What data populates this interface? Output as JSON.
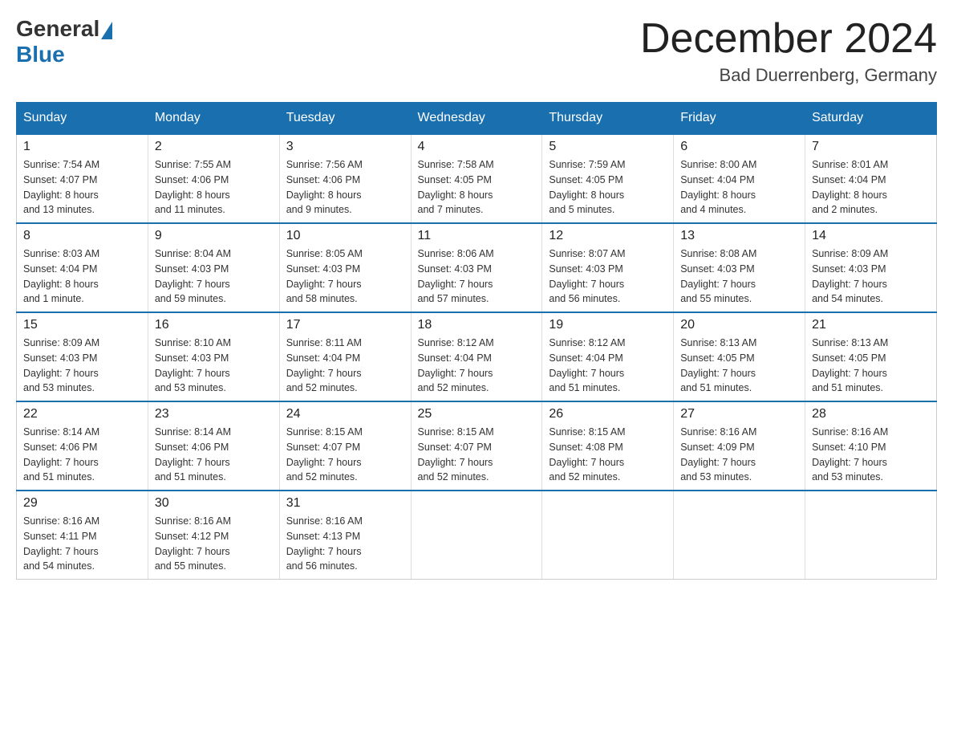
{
  "logo": {
    "general": "General",
    "blue": "Blue"
  },
  "title": {
    "month_year": "December 2024",
    "location": "Bad Duerrenberg, Germany"
  },
  "headers": [
    "Sunday",
    "Monday",
    "Tuesday",
    "Wednesday",
    "Thursday",
    "Friday",
    "Saturday"
  ],
  "weeks": [
    [
      {
        "day": "1",
        "info": "Sunrise: 7:54 AM\nSunset: 4:07 PM\nDaylight: 8 hours\nand 13 minutes."
      },
      {
        "day": "2",
        "info": "Sunrise: 7:55 AM\nSunset: 4:06 PM\nDaylight: 8 hours\nand 11 minutes."
      },
      {
        "day": "3",
        "info": "Sunrise: 7:56 AM\nSunset: 4:06 PM\nDaylight: 8 hours\nand 9 minutes."
      },
      {
        "day": "4",
        "info": "Sunrise: 7:58 AM\nSunset: 4:05 PM\nDaylight: 8 hours\nand 7 minutes."
      },
      {
        "day": "5",
        "info": "Sunrise: 7:59 AM\nSunset: 4:05 PM\nDaylight: 8 hours\nand 5 minutes."
      },
      {
        "day": "6",
        "info": "Sunrise: 8:00 AM\nSunset: 4:04 PM\nDaylight: 8 hours\nand 4 minutes."
      },
      {
        "day": "7",
        "info": "Sunrise: 8:01 AM\nSunset: 4:04 PM\nDaylight: 8 hours\nand 2 minutes."
      }
    ],
    [
      {
        "day": "8",
        "info": "Sunrise: 8:03 AM\nSunset: 4:04 PM\nDaylight: 8 hours\nand 1 minute."
      },
      {
        "day": "9",
        "info": "Sunrise: 8:04 AM\nSunset: 4:03 PM\nDaylight: 7 hours\nand 59 minutes."
      },
      {
        "day": "10",
        "info": "Sunrise: 8:05 AM\nSunset: 4:03 PM\nDaylight: 7 hours\nand 58 minutes."
      },
      {
        "day": "11",
        "info": "Sunrise: 8:06 AM\nSunset: 4:03 PM\nDaylight: 7 hours\nand 57 minutes."
      },
      {
        "day": "12",
        "info": "Sunrise: 8:07 AM\nSunset: 4:03 PM\nDaylight: 7 hours\nand 56 minutes."
      },
      {
        "day": "13",
        "info": "Sunrise: 8:08 AM\nSunset: 4:03 PM\nDaylight: 7 hours\nand 55 minutes."
      },
      {
        "day": "14",
        "info": "Sunrise: 8:09 AM\nSunset: 4:03 PM\nDaylight: 7 hours\nand 54 minutes."
      }
    ],
    [
      {
        "day": "15",
        "info": "Sunrise: 8:09 AM\nSunset: 4:03 PM\nDaylight: 7 hours\nand 53 minutes."
      },
      {
        "day": "16",
        "info": "Sunrise: 8:10 AM\nSunset: 4:03 PM\nDaylight: 7 hours\nand 53 minutes."
      },
      {
        "day": "17",
        "info": "Sunrise: 8:11 AM\nSunset: 4:04 PM\nDaylight: 7 hours\nand 52 minutes."
      },
      {
        "day": "18",
        "info": "Sunrise: 8:12 AM\nSunset: 4:04 PM\nDaylight: 7 hours\nand 52 minutes."
      },
      {
        "day": "19",
        "info": "Sunrise: 8:12 AM\nSunset: 4:04 PM\nDaylight: 7 hours\nand 51 minutes."
      },
      {
        "day": "20",
        "info": "Sunrise: 8:13 AM\nSunset: 4:05 PM\nDaylight: 7 hours\nand 51 minutes."
      },
      {
        "day": "21",
        "info": "Sunrise: 8:13 AM\nSunset: 4:05 PM\nDaylight: 7 hours\nand 51 minutes."
      }
    ],
    [
      {
        "day": "22",
        "info": "Sunrise: 8:14 AM\nSunset: 4:06 PM\nDaylight: 7 hours\nand 51 minutes."
      },
      {
        "day": "23",
        "info": "Sunrise: 8:14 AM\nSunset: 4:06 PM\nDaylight: 7 hours\nand 51 minutes."
      },
      {
        "day": "24",
        "info": "Sunrise: 8:15 AM\nSunset: 4:07 PM\nDaylight: 7 hours\nand 52 minutes."
      },
      {
        "day": "25",
        "info": "Sunrise: 8:15 AM\nSunset: 4:07 PM\nDaylight: 7 hours\nand 52 minutes."
      },
      {
        "day": "26",
        "info": "Sunrise: 8:15 AM\nSunset: 4:08 PM\nDaylight: 7 hours\nand 52 minutes."
      },
      {
        "day": "27",
        "info": "Sunrise: 8:16 AM\nSunset: 4:09 PM\nDaylight: 7 hours\nand 53 minutes."
      },
      {
        "day": "28",
        "info": "Sunrise: 8:16 AM\nSunset: 4:10 PM\nDaylight: 7 hours\nand 53 minutes."
      }
    ],
    [
      {
        "day": "29",
        "info": "Sunrise: 8:16 AM\nSunset: 4:11 PM\nDaylight: 7 hours\nand 54 minutes."
      },
      {
        "day": "30",
        "info": "Sunrise: 8:16 AM\nSunset: 4:12 PM\nDaylight: 7 hours\nand 55 minutes."
      },
      {
        "day": "31",
        "info": "Sunrise: 8:16 AM\nSunset: 4:13 PM\nDaylight: 7 hours\nand 56 minutes."
      },
      null,
      null,
      null,
      null
    ]
  ]
}
